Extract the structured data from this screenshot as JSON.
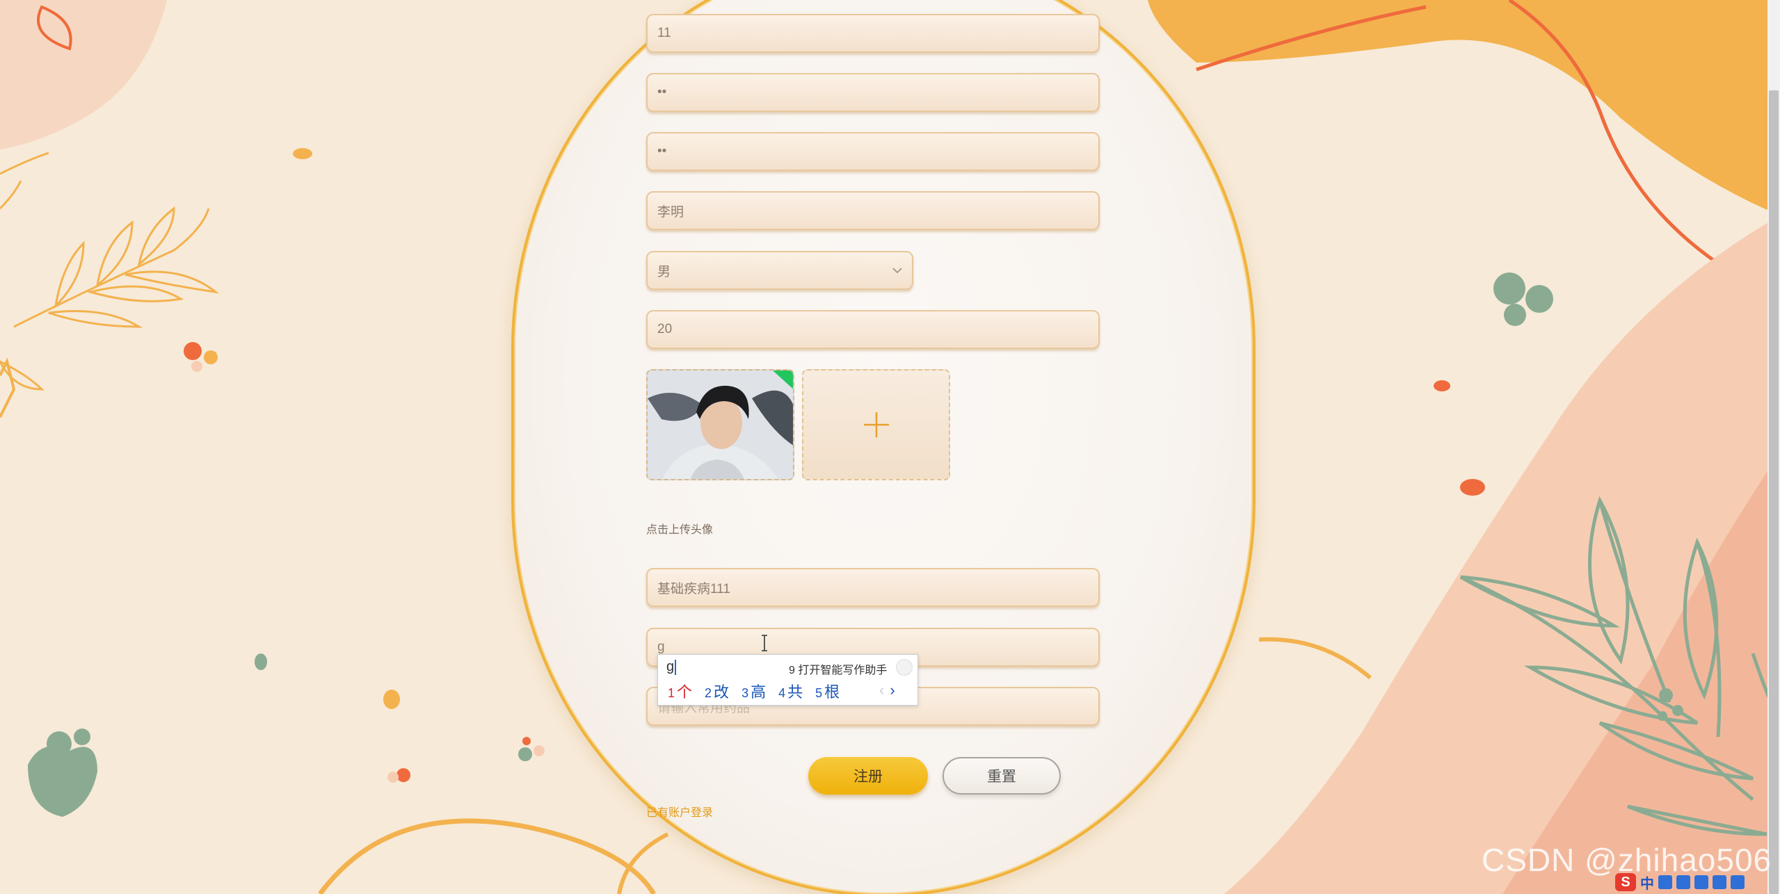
{
  "form": {
    "account": "11",
    "password": "••",
    "confirm_password": "••",
    "name": "李明",
    "gender": "男",
    "age": "20",
    "upload_hint": "点击上传头像",
    "disease": "基础疾病111",
    "current_input": "g",
    "next_placeholder": "请输入常用药品"
  },
  "buttons": {
    "register": "注册",
    "reset": "重置"
  },
  "links": {
    "login": "已有账户登录"
  },
  "ime": {
    "input": "g",
    "assist_num": "9",
    "assist_label": "打开智能写作助手",
    "candidates": [
      {
        "num": "1",
        "text": "个"
      },
      {
        "num": "2",
        "text": "改"
      },
      {
        "num": "3",
        "text": "高"
      },
      {
        "num": "4",
        "text": "共"
      },
      {
        "num": "5",
        "text": "根"
      }
    ],
    "prev": "‹",
    "next": "›"
  },
  "watermark": "CSDN @zhihao506",
  "tray": {
    "logo": "S",
    "lang": "中"
  },
  "colors": {
    "accent": "#f0b23a",
    "button": "#efb10b",
    "link": "#e29a17"
  }
}
